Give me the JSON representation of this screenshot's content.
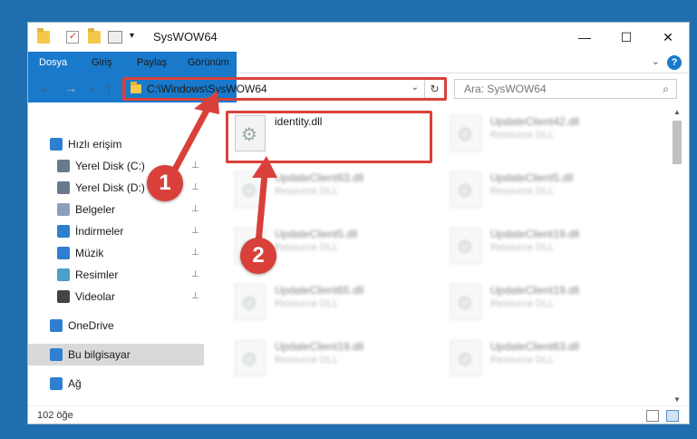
{
  "window": {
    "title": "SysWOW64",
    "minimize_glyph": "—",
    "maximize_glyph": "☐",
    "close_glyph": "✕"
  },
  "ribbon": {
    "tabs": [
      "Dosya",
      "Giriş",
      "Paylaş",
      "Görünüm"
    ],
    "collapse_glyph": "⌄",
    "help_glyph": "?"
  },
  "nav": {
    "back_glyph": "←",
    "forward_glyph": "→",
    "recent_glyph": "⌄",
    "up_glyph": "↑",
    "address": "C:\\Windows\\SysWOW64",
    "address_drop_glyph": "⌄",
    "refresh_glyph": "↻",
    "search_placeholder": "Ara: SysWOW64",
    "search_glyph": "⌕"
  },
  "sidebar": {
    "items": [
      {
        "label": "Hızlı erişim",
        "icon": "star-icon",
        "color": "#2f7fd0",
        "pinned": false
      },
      {
        "label": "Yerel Disk (C:)",
        "icon": "drive-icon",
        "color": "#6b7a8a",
        "pinned": true
      },
      {
        "label": "Yerel Disk (D:)",
        "icon": "drive-icon",
        "color": "#6b7a8a",
        "pinned": true
      },
      {
        "label": "Belgeler",
        "icon": "documents-icon",
        "color": "#8aa0b8",
        "pinned": true
      },
      {
        "label": "İndirmeler",
        "icon": "downloads-icon",
        "color": "#2f7fd0",
        "pinned": true
      },
      {
        "label": "Müzik",
        "icon": "music-icon",
        "color": "#2f7fd0",
        "pinned": true
      },
      {
        "label": "Resimler",
        "icon": "pictures-icon",
        "color": "#4aa0c8",
        "pinned": true
      },
      {
        "label": "Videolar",
        "icon": "videos-icon",
        "color": "#444",
        "pinned": true
      },
      {
        "label": "OneDrive",
        "icon": "cloud-icon",
        "color": "#2f7fd0",
        "pinned": false
      },
      {
        "label": "Bu bilgisayar",
        "icon": "computer-icon",
        "color": "#2f7fd0",
        "pinned": false
      },
      {
        "label": "Ağ",
        "icon": "network-icon",
        "color": "#2f7fd0",
        "pinned": false
      }
    ],
    "pin_glyph": "📌"
  },
  "files": [
    {
      "name": "identity.dll",
      "type": "",
      "highlight": true
    },
    {
      "name": "UpdateClient42.dll",
      "type": "Resource DLL"
    },
    {
      "name": "UpdateClient63.dll",
      "type": "Resource DLL"
    },
    {
      "name": "UpdateClient5.dll",
      "type": "Resource DLL"
    },
    {
      "name": "UpdateClient5.dll",
      "type": "Resource DLL"
    },
    {
      "name": "UpdateClient19.dll",
      "type": "Resource DLL"
    },
    {
      "name": "UpdateClient65.dll",
      "type": "Resource DLL"
    },
    {
      "name": "UpdateClient19.dll",
      "type": "Resource DLL"
    },
    {
      "name": "UpdateClient19.dll",
      "type": "Resource DLL"
    },
    {
      "name": "UpdateClient63.dll",
      "type": "Resource DLL"
    }
  ],
  "status": {
    "count": "102 öğe"
  },
  "annotations": {
    "step1": "1",
    "step2": "2",
    "color": "#d9403a"
  }
}
